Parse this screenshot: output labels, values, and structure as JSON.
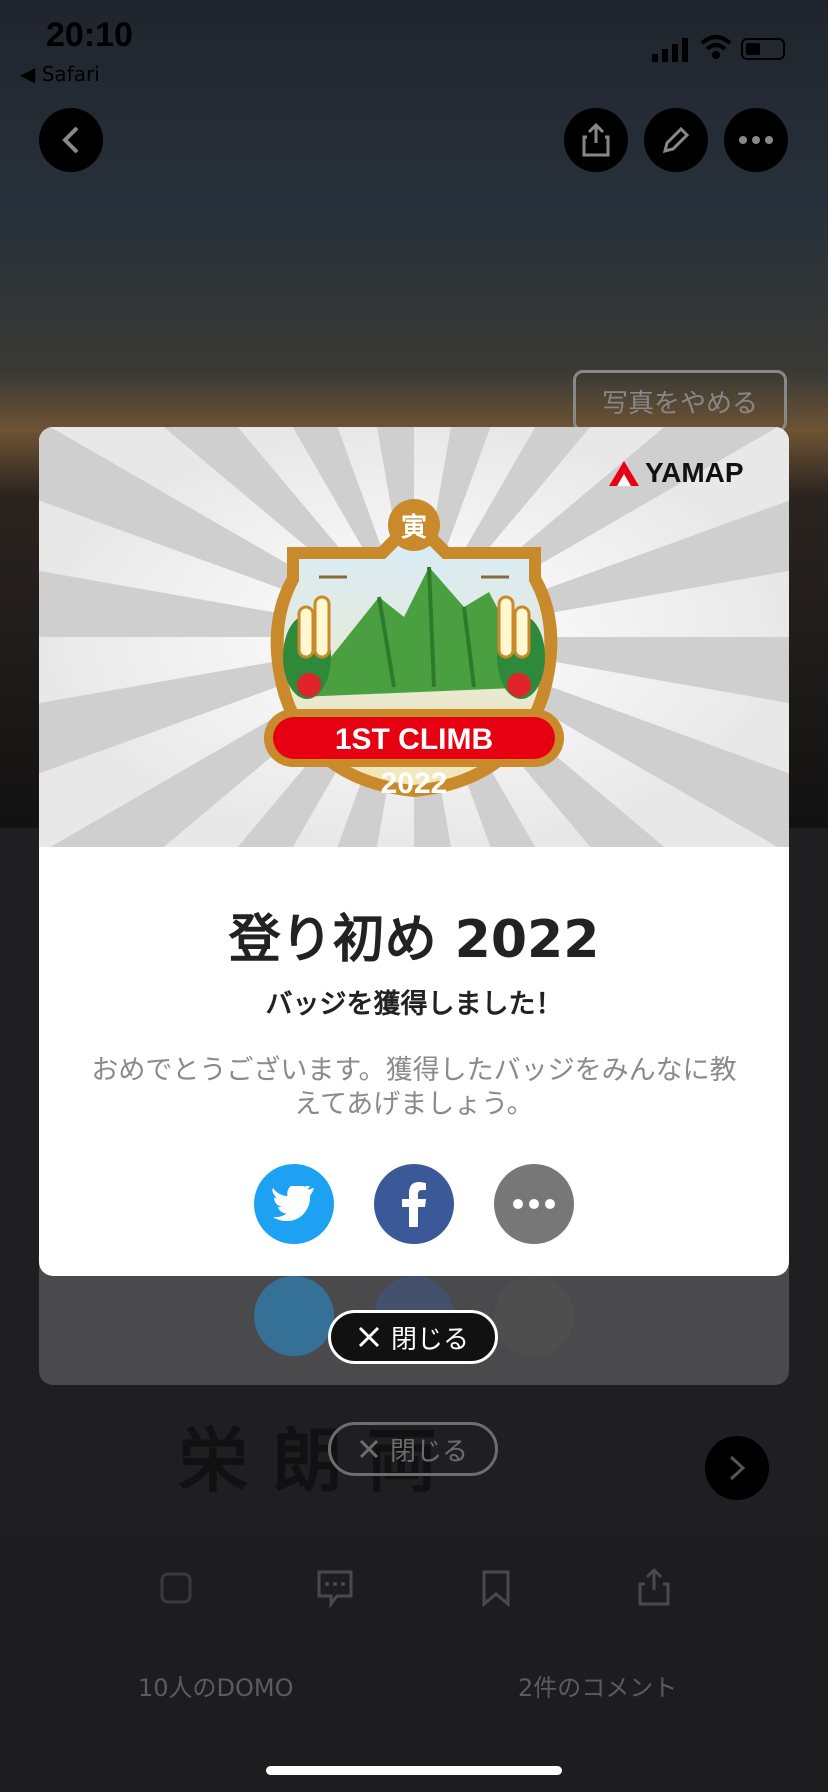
{
  "status_bar": {
    "time": "20:10",
    "back_app": "◀ Safari"
  },
  "header": {
    "photo_toggle_label": "写真をやめる"
  },
  "modal": {
    "brand": "YAMAP",
    "badge": {
      "kanji": "寅",
      "banner_text": "1ST CLIMB",
      "year": "2022"
    },
    "title": "登り初め 2022",
    "subtitle": "バッジを獲得しました！",
    "body": "おめでとうございます。獲得したバッジをみんなに教えてあげましょう。",
    "share": [
      "twitter-icon",
      "facebook-icon",
      "more-icon"
    ],
    "close_label": "閉じる"
  },
  "background": {
    "close_label_ghost": "閉じる",
    "title_ghost": "栄 朗 両"
  },
  "bottom_bar": {
    "domo_label": "10人のDOMO",
    "comment_label": "2件のコメント"
  },
  "colors": {
    "twitter": "#1da1f2",
    "facebook": "#3b5998",
    "more": "#777777",
    "brand_red": "#e60012"
  }
}
